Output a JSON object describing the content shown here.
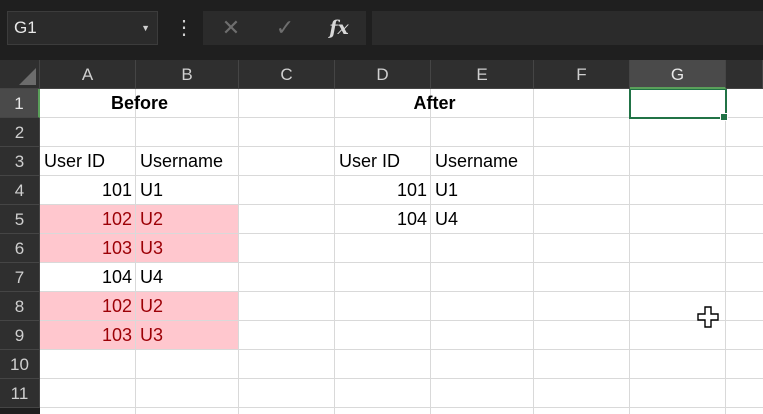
{
  "name_box": {
    "value": "G1"
  },
  "formula_bar": {
    "cancel_icon": "✕",
    "enter_icon": "✓",
    "fx_label": "fx",
    "formula": ""
  },
  "columns": [
    "A",
    "B",
    "C",
    "D",
    "E",
    "F",
    "G"
  ],
  "rows": [
    "1",
    "2",
    "3",
    "4",
    "5",
    "6",
    "7",
    "8",
    "9",
    "10",
    "11"
  ],
  "selected_cell": "G1",
  "sheet": {
    "before_header": "Before",
    "after_header": "After",
    "before_table": {
      "col_user_id": "User ID",
      "col_username": "Username",
      "rows": [
        {
          "id": "101",
          "name": "U1",
          "highlight": false
        },
        {
          "id": "102",
          "name": "U2",
          "highlight": true
        },
        {
          "id": "103",
          "name": "U3",
          "highlight": true
        },
        {
          "id": "104",
          "name": "U4",
          "highlight": false
        },
        {
          "id": "102",
          "name": "U2",
          "highlight": true
        },
        {
          "id": "103",
          "name": "U3",
          "highlight": true
        }
      ]
    },
    "after_table": {
      "col_user_id": "User ID",
      "col_username": "Username",
      "rows": [
        {
          "id": "101",
          "name": "U1"
        },
        {
          "id": "104",
          "name": "U4"
        }
      ]
    }
  },
  "colors": {
    "duplicate_fill": "#ffc7ce",
    "duplicate_text": "#9c0006",
    "selection": "#217346"
  }
}
